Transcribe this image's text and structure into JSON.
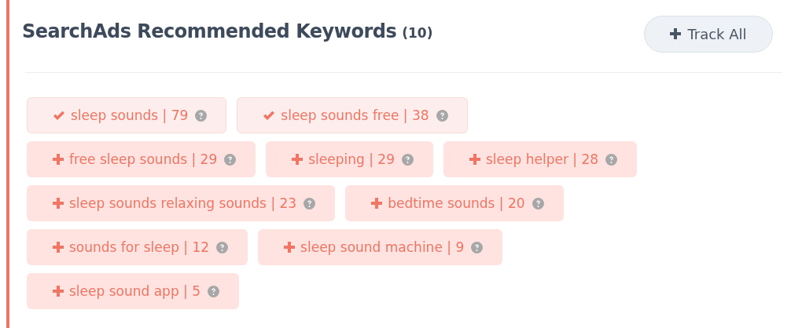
{
  "panel": {
    "title": "SearchAds Recommended Keywords",
    "count": "(10)",
    "track_all_button": "Track All"
  },
  "keyword_rows": [
    [
      {
        "label": "sleep sounds | 79",
        "tracked": true
      },
      {
        "label": "sleep sounds free | 38",
        "tracked": true
      }
    ],
    [
      {
        "label": "free sleep sounds | 29",
        "tracked": false
      },
      {
        "label": "sleeping | 29",
        "tracked": false
      },
      {
        "label": "sleep helper | 28",
        "tracked": false
      }
    ],
    [
      {
        "label": "sleep sounds relaxing sounds | 23",
        "tracked": false
      },
      {
        "label": "bedtime sounds | 20",
        "tracked": false
      }
    ],
    [
      {
        "label": "sounds for sleep | 12",
        "tracked": false
      },
      {
        "label": "sleep sound machine | 9",
        "tracked": false
      }
    ],
    [
      {
        "label": "sleep sound app | 5",
        "tracked": false
      }
    ]
  ]
}
